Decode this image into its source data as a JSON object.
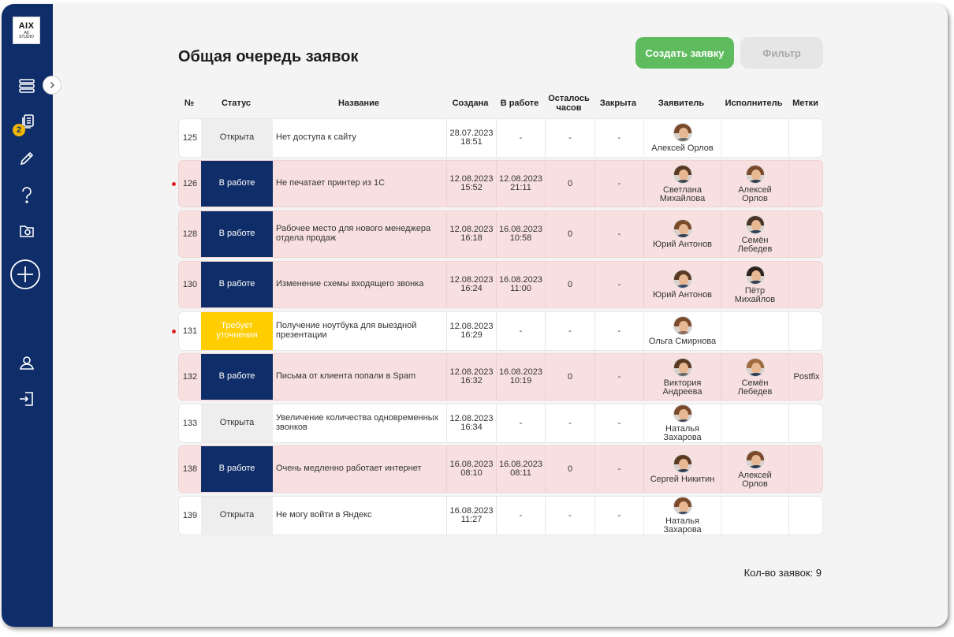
{
  "logo": {
    "line1": "AIX",
    "line2": "A9",
    "line3": "STUDIO"
  },
  "sidebar": {
    "badge": "2"
  },
  "page_title": "Общая очередь заявок",
  "buttons": {
    "create": "Создать заявку",
    "filter": "Фильтр"
  },
  "columns": [
    "№",
    "Статус",
    "Название",
    "Создана",
    "В работе",
    "Осталось часов",
    "Закрыта",
    "Заявитель",
    "Исполнитель",
    "Метки"
  ],
  "rows": [
    {
      "num": "125",
      "status": "Открыта",
      "name": "Нет доступа к сайту",
      "created": "28.07.2023 18:51",
      "in_work": "-",
      "left": "-",
      "closed": "-",
      "applicant": "Алексей Орлов",
      "executor": "",
      "tags": ""
    },
    {
      "num": "126",
      "status": "В работе",
      "name": "Не печатает принтер из 1С",
      "created": "12.08.2023 15:52",
      "in_work": "12.08.2023 21:11",
      "left": "0",
      "closed": "-",
      "applicant": "Светлана Михайлова",
      "executor": "Алексей Орлов",
      "tags": ""
    },
    {
      "num": "128",
      "status": "В работе",
      "name": "Рабочее место для нового менеджера отдела продаж",
      "created": "12.08.2023 16:18",
      "in_work": "16.08.2023 10:58",
      "left": "0",
      "closed": "-",
      "applicant": "Юрий Антонов",
      "executor": "Семён Лебедев",
      "tags": ""
    },
    {
      "num": "130",
      "status": "В работе",
      "name": "Изменение схемы входящего звонка",
      "created": "12.08.2023 16:24",
      "in_work": "16.08.2023 11:00",
      "left": "0",
      "closed": "-",
      "applicant": "Юрий Антонов",
      "executor": "Пётр Михайлов",
      "tags": ""
    },
    {
      "num": "131",
      "status": "Требует уточнения",
      "name": "Получение ноутбука для выездной презентации",
      "created": "12.08.2023 16:29",
      "in_work": "-",
      "left": "-",
      "closed": "-",
      "applicant": "Ольга Смирнова",
      "executor": "",
      "tags": ""
    },
    {
      "num": "132",
      "status": "В работе",
      "name": "Письма от клиента попали в Spam",
      "created": "12.08.2023 16:32",
      "in_work": "16.08.2023 10:19",
      "left": "0",
      "closed": "-",
      "applicant": "Виктория Андреева",
      "executor": "Семён Лебедев",
      "tags": "Postfix"
    },
    {
      "num": "133",
      "status": "Открыта",
      "name": "Увеличение количества одновременных звонков",
      "created": "12.08.2023 16:34",
      "in_work": "-",
      "left": "-",
      "closed": "-",
      "applicant": "Наталья Захарова",
      "executor": "",
      "tags": ""
    },
    {
      "num": "138",
      "status": "В работе",
      "name": "Очень медленно работает интернет",
      "created": "16.08.2023 08:10",
      "in_work": "16.08.2023 08:11",
      "left": "0",
      "closed": "-",
      "applicant": "Сергей Никитин",
      "executor": "Алексей Орлов",
      "tags": ""
    },
    {
      "num": "139",
      "status": "Открыта",
      "name": "Не могу войти в Яндекс",
      "created": "16.08.2023 11:27",
      "in_work": "-",
      "left": "-",
      "closed": "-",
      "applicant": "Наталья Захарова",
      "executor": "",
      "tags": ""
    }
  ],
  "footer": {
    "count_label": "Кол-во заявок: 9"
  },
  "colors": {
    "sidebar": "#0f2d69",
    "create_button": "#5ebb5e",
    "status_open": "#eeeeee",
    "status_work": "#0f2d69",
    "status_clarify": "#ffcd00",
    "row_highlight": "#f9e0e0",
    "urgent_dot": "#e02020"
  }
}
